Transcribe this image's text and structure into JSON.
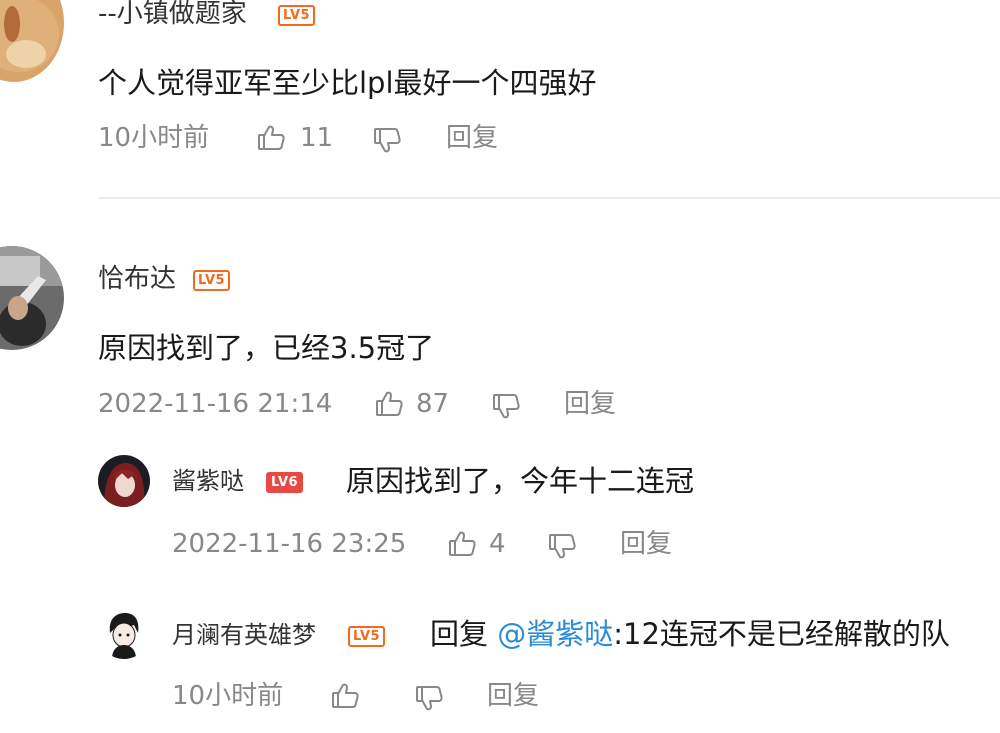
{
  "colors": {
    "level_badge": "#f26b1d",
    "level_badge_lv6": "#e84a43",
    "mention": "#2a8bd8",
    "meta_text": "#888888"
  },
  "comments": [
    {
      "username": "--小镇做题家",
      "level": "LV5",
      "text": "个人觉得亚军至少比lpl最好一个四强好",
      "time": "10小时前",
      "likes": "11",
      "reply_label": "回复"
    },
    {
      "username": "恰布达",
      "level": "LV5",
      "text": "原因找到了，已经3.5冠了",
      "time": "2022-11-16 21:14",
      "likes": "87",
      "reply_label": "回复",
      "replies": [
        {
          "username": "酱紫哒",
          "level": "LV6",
          "text": "原因找到了，今年十二连冠",
          "time": "2022-11-16 23:25",
          "likes": "4",
          "reply_label": "回复"
        },
        {
          "username": "月澜有英雄梦",
          "level": "LV5",
          "reply_prefix": "回复 ",
          "mention": "@酱紫哒",
          "text": ":12连冠不是已经解散的队",
          "time": "10小时前",
          "likes": "",
          "reply_label": "回复"
        }
      ]
    }
  ]
}
